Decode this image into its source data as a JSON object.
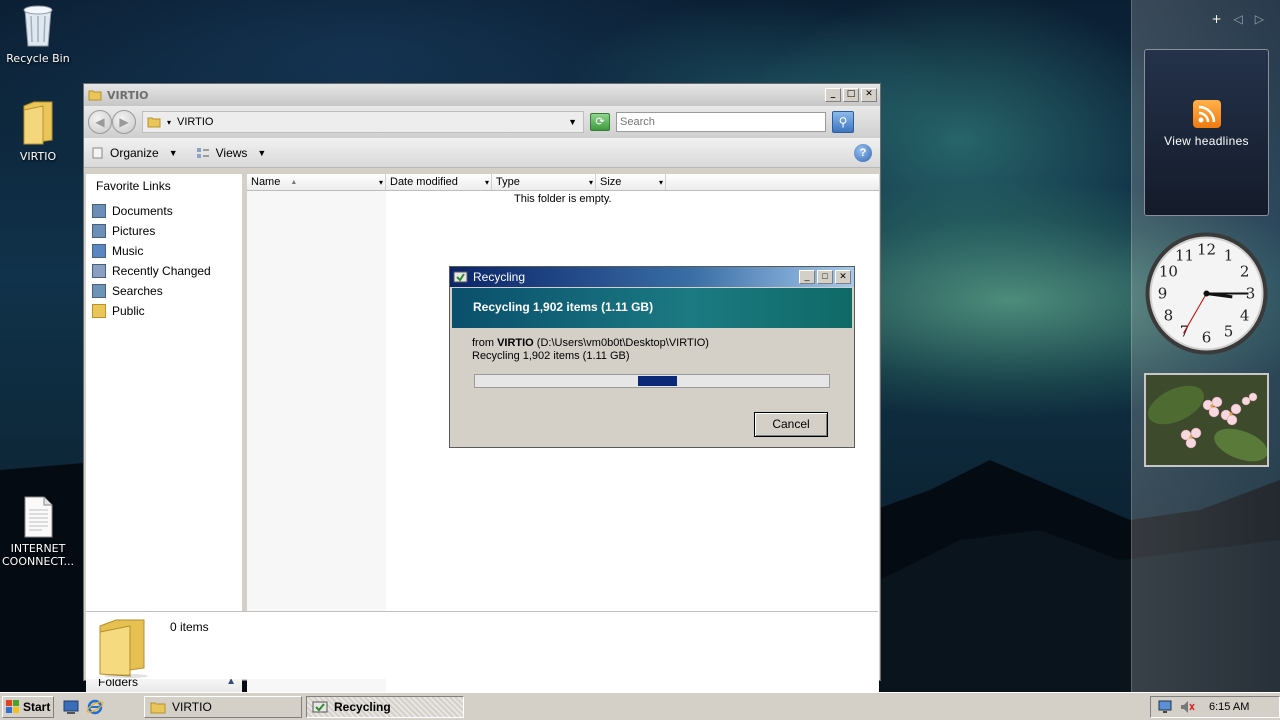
{
  "desktop": {
    "icons": {
      "recycle_bin": "Recycle Bin",
      "virtio": "VIRTIO",
      "internet_connect": "INTERNET COONNECT..."
    }
  },
  "explorer": {
    "title": "VIRTIO",
    "address": "VIRTIO",
    "search_placeholder": "Search",
    "toolbar": {
      "organize": "Organize",
      "views": "Views"
    },
    "nav": {
      "favorite_links_title": "Favorite Links",
      "items": [
        {
          "label": "Documents",
          "icon": "documents-icon"
        },
        {
          "label": "Pictures",
          "icon": "pictures-icon"
        },
        {
          "label": "Music",
          "icon": "music-icon"
        },
        {
          "label": "Recently Changed",
          "icon": "recently-changed-icon"
        },
        {
          "label": "Searches",
          "icon": "searches-icon"
        },
        {
          "label": "Public",
          "icon": "folder-icon"
        }
      ],
      "folders_label": "Folders"
    },
    "columns": [
      "Name",
      "Date modified",
      "Type",
      "Size"
    ],
    "empty_message": "This folder is empty.",
    "details": {
      "items_count": "0 items"
    }
  },
  "dialog": {
    "title": "Recycling",
    "banner": "Recycling 1,902 items (1.11 GB)",
    "from_prefix": "from",
    "from_source": "VIRTIO",
    "from_path": "(D:\\Users\\vm0b0t\\Desktop\\VIRTIO)",
    "status": "Recycling 1,902 items (1.11 GB)",
    "progress_chunk_fraction": {
      "start": 0.46,
      "end": 0.57
    },
    "cancel_label": "Cancel"
  },
  "sidebar": {
    "rss_label": "View headlines",
    "clock_time": {
      "hour": 3,
      "minute": 15,
      "second": 35
    }
  },
  "taskbar": {
    "start_label": "Start",
    "tasks": [
      {
        "label": "VIRTIO",
        "active": false
      },
      {
        "label": "Recycling",
        "active": true
      }
    ],
    "clock": "6:15 AM"
  },
  "colors": {
    "dialog_title_start": "#0a246a",
    "dialog_banner": "#1b7a82",
    "progress": "#0a2a78",
    "rss_orange": "#ef7a10"
  }
}
